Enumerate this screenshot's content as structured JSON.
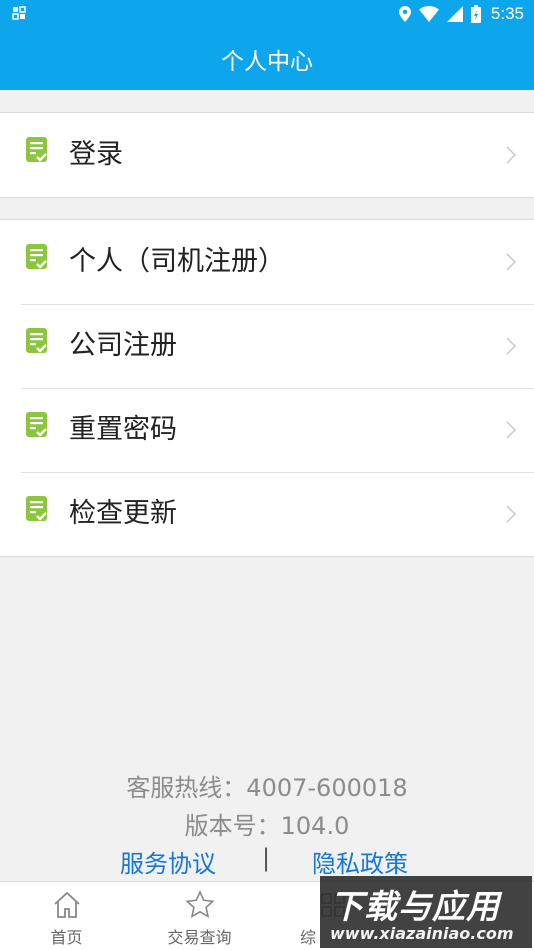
{
  "status_bar": {
    "time": "5:35",
    "icons": [
      "notification-icon",
      "location-icon",
      "wifi-icon",
      "signal-icon",
      "battery-icon"
    ]
  },
  "header": {
    "title": "个人中心"
  },
  "menu": {
    "group1": [
      {
        "label": "登录",
        "icon": "document-check-icon"
      }
    ],
    "group2": [
      {
        "label": "个人（司机注册）",
        "icon": "document-check-icon"
      },
      {
        "label": "公司注册",
        "icon": "document-check-icon"
      },
      {
        "label": "重置密码",
        "icon": "document-check-icon"
      },
      {
        "label": "检查更新",
        "icon": "document-check-icon"
      }
    ]
  },
  "info": {
    "hotline": "客服热线：4007-600018",
    "version": "版本号：104.0"
  },
  "links": {
    "service_agreement": "服务协议",
    "separator": "|",
    "privacy_policy": "隐私政策"
  },
  "tabbar": {
    "items": [
      {
        "label": "首页",
        "icon": "home-icon"
      },
      {
        "label": "交易查询",
        "icon": "star-icon"
      },
      {
        "label": "综",
        "icon": "grid-icon"
      }
    ]
  },
  "watermark": {
    "title": "下载与应用",
    "url": "www.xiazainiao.com"
  },
  "colors": {
    "accent": "#0da6ec",
    "icon_green": "#8cc63f",
    "link": "#1677d6",
    "background": "#f1f1f1"
  }
}
